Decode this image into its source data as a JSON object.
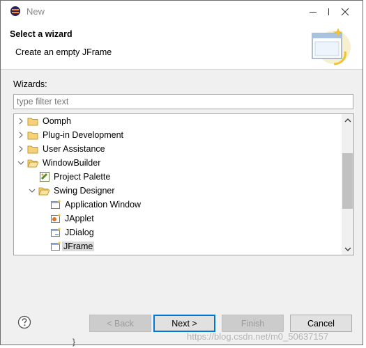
{
  "window": {
    "title": "New",
    "controls": [
      "minimize-icon",
      "maximize-icon",
      "close-icon"
    ]
  },
  "banner": {
    "title": "Select a wizard",
    "description": "Create an empty JFrame",
    "image_icon": "new-window-wizard-icon"
  },
  "wizards": {
    "label": "Wizards:",
    "filter_placeholder": "type filter text",
    "filter_value": ""
  },
  "tree": {
    "items": [
      {
        "label": "Oomph",
        "icon": "folder-icon",
        "expanded": false
      },
      {
        "label": "Plug-in Development",
        "icon": "folder-icon",
        "expanded": false
      },
      {
        "label": "User Assistance",
        "icon": "folder-icon",
        "expanded": false
      },
      {
        "label": "WindowBuilder",
        "icon": "folder-open-icon",
        "expanded": true
      },
      {
        "label": "Project Palette",
        "icon": "palette-icon"
      },
      {
        "label": "Swing Designer",
        "icon": "folder-open-icon",
        "expanded": true
      },
      {
        "label": "Application Window",
        "icon": "window-icon"
      },
      {
        "label": "JApplet",
        "icon": "applet-icon"
      },
      {
        "label": "JDialog",
        "icon": "dialog-icon"
      },
      {
        "label": "JFrame",
        "icon": "window-icon",
        "selected": true
      }
    ]
  },
  "buttons": {
    "back": "< Back",
    "next": "Next >",
    "finish": "Finish",
    "cancel": "Cancel"
  },
  "watermark": "https://blog.csdn.net/m0_50637157",
  "stray_text": "}"
}
